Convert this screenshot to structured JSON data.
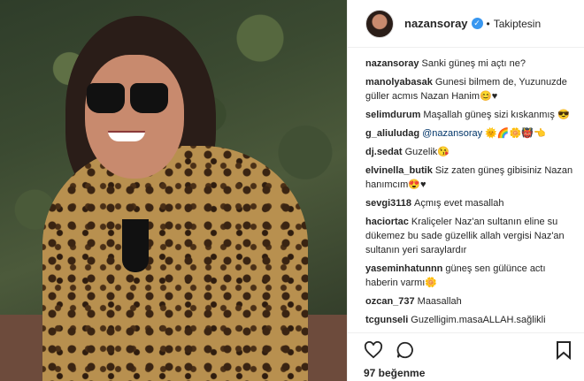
{
  "post": {
    "username": "nazansoray",
    "follow_status": "Takiptesin",
    "separator": "•",
    "verified_mark": "✓"
  },
  "comments": [
    {
      "user": "nazansoray",
      "text": "Sanki güneş mi açtı ne?"
    },
    {
      "user": "manolyabasak",
      "text": "Gunesi bilmem de, Yuzunuzde güller acmıs Nazan Hanim😊♥"
    },
    {
      "user": "selimdurum",
      "text": "Maşallah güneş sizi kıskanmış 😎"
    },
    {
      "user": "g_aliuludag",
      "mention": "@nazansoray",
      "text": " 🌞🌈🌼👹👈"
    },
    {
      "user": "dj.sedat",
      "text": "Guzelik😘"
    },
    {
      "user": "elvinella_butik",
      "text": "Siz zaten güneş gibisiniz Nazan hanımcım😍♥"
    },
    {
      "user": "sevgi3118",
      "text": "Açmış evet masallah"
    },
    {
      "user": "haciortac",
      "text": "Kraliçeler Naz'an sultanın eline su dükemez bu sade güzellik allah vergisi Naz'an sultanın yeri saraylardır"
    },
    {
      "user": "yaseminhatunnn",
      "text": "güneş sen gülünce actı haberin varmı🌼"
    },
    {
      "user": "ozcan_737",
      "text": "Maasallah"
    },
    {
      "user": "tcgunseli",
      "text": "Guzelligim.masaALLAH.sağlikli"
    }
  ],
  "footer": {
    "likes": "97 beğenme",
    "icons": [
      "heart-icon",
      "comment-icon",
      "bookmark-icon"
    ]
  },
  "colors": {
    "verified": "#3897f0",
    "mention": "#003569",
    "text": "#262626"
  }
}
